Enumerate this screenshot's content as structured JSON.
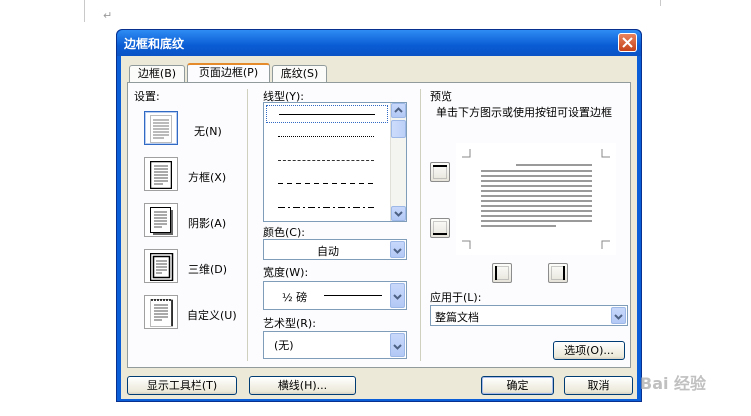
{
  "document": {
    "paragraph_mark": "↵"
  },
  "dialog": {
    "title": "边框和底纹",
    "tabs": [
      {
        "label": "边框(B)"
      },
      {
        "label": "页面边框(P)"
      },
      {
        "label": "底纹(S)"
      }
    ],
    "settings": {
      "heading": "设置:",
      "items": [
        {
          "label": "无(N)",
          "icon": "no-border-icon",
          "selected": true
        },
        {
          "label": "方框(X)",
          "icon": "box-border-icon",
          "selected": false
        },
        {
          "label": "阴影(A)",
          "icon": "shadow-border-icon",
          "selected": false
        },
        {
          "label": "三维(D)",
          "icon": "3d-border-icon",
          "selected": false
        },
        {
          "label": "自定义(U)",
          "icon": "custom-border-icon",
          "selected": false
        }
      ]
    },
    "style": {
      "label": "线型(Y):",
      "line_styles": [
        "solid",
        "dotted",
        "dashed-fine",
        "dashed",
        "dash-dot"
      ]
    },
    "color": {
      "label": "颜色(C):",
      "value": "自动"
    },
    "width": {
      "label": "宽度(W):",
      "value": "½ 磅"
    },
    "art": {
      "label": "艺术型(R):",
      "value": "(无)"
    },
    "preview": {
      "heading": "预览",
      "hint": "单击下方图示或使用按钮可设置边框"
    },
    "apply_to": {
      "label": "应用于(L):",
      "value": "整篇文档"
    },
    "options_button": "选项(O)...",
    "footer": {
      "toolbar_button": "显示工具栏(T)",
      "hline_button": "横线(H)...",
      "ok_button": "确定",
      "cancel_button": "取消"
    }
  },
  "watermark": "Bai 经验",
  "colors": {
    "title_bar": "#0a5cd4",
    "dialog_face": "#ece9d8",
    "active_tab_accent": "#e68b2c",
    "close_button": "#c4421a"
  }
}
